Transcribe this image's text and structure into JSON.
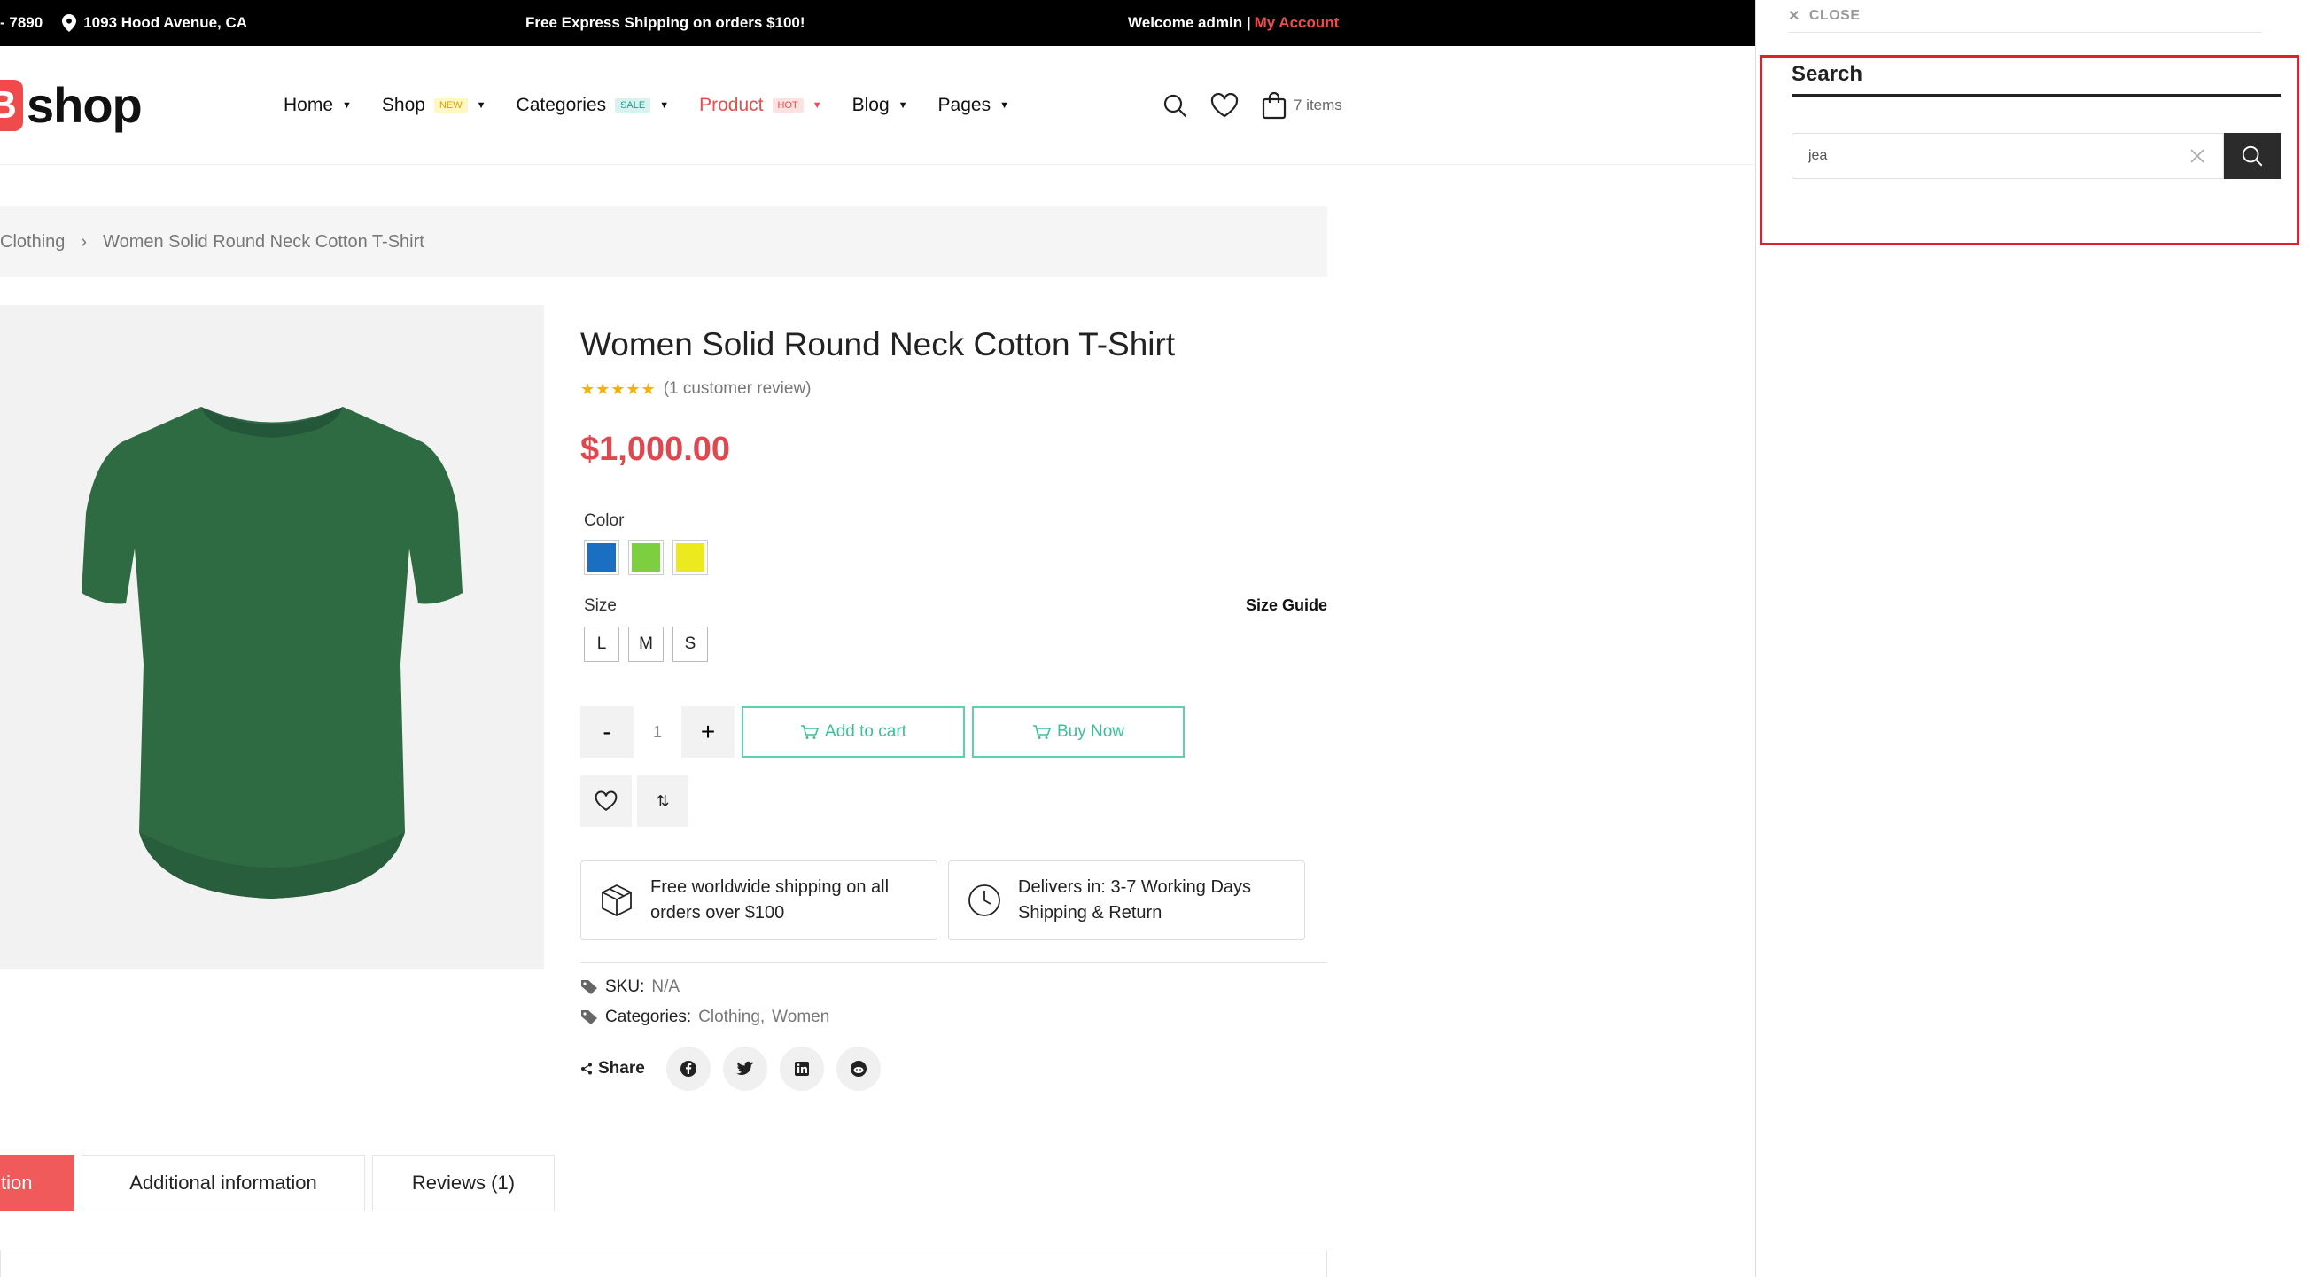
{
  "topbar": {
    "phone": "- 7890",
    "address": "1093 Hood Avenue, CA",
    "promo": "Free Express Shipping on orders $100!",
    "welcome": "Welcome admin |",
    "account": "My Account"
  },
  "header": {
    "logo_mark": "B",
    "logo_text": "shop",
    "cart_count": "7 items"
  },
  "nav": [
    {
      "label": "Home",
      "badge": ""
    },
    {
      "label": "Shop",
      "badge": "NEW"
    },
    {
      "label": "Categories",
      "badge": "SALE"
    },
    {
      "label": "Product",
      "badge": "HOT"
    },
    {
      "label": "Blog",
      "badge": ""
    },
    {
      "label": "Pages",
      "badge": ""
    }
  ],
  "breadcrumb": {
    "category": "Clothing",
    "separator": "›",
    "current": "Women Solid Round Neck Cotton T-Shirt"
  },
  "product": {
    "title": "Women Solid Round Neck Cotton T-Shirt",
    "stars": "★★★★★",
    "reviews": "(1 customer review)",
    "price": "$1,000.00",
    "color_label": "Color",
    "colors": [
      "#1a6fc2",
      "#7ccf3e",
      "#ecea1f"
    ],
    "size_label": "Size",
    "size_guide": "Size Guide",
    "sizes": [
      "L",
      "M",
      "S"
    ],
    "qty_minus": "-",
    "qty_value": "1",
    "qty_plus": "+",
    "add_to_cart": "Add to cart",
    "buy_now": "Buy Now",
    "compare_glyph": "⇅",
    "shipping_info": "Free worldwide shipping on all orders over $100",
    "delivery_line1": "Delivers in: 3-7 Working Days",
    "delivery_line2": "Shipping & Return",
    "sku_label": "SKU:",
    "sku_value": "N/A",
    "categories_label": "Categories:",
    "category_1": "Clothing",
    "category_sep": ",",
    "category_2": "Women",
    "share_label": "Share",
    "shirt_color": "#2f6b42"
  },
  "tabs": {
    "description": "tion",
    "additional": "Additional information",
    "reviews": "Reviews (1)"
  },
  "search_panel": {
    "close_glyph": "✕",
    "close": "CLOSE",
    "title": "Search",
    "input_value": "jea"
  }
}
